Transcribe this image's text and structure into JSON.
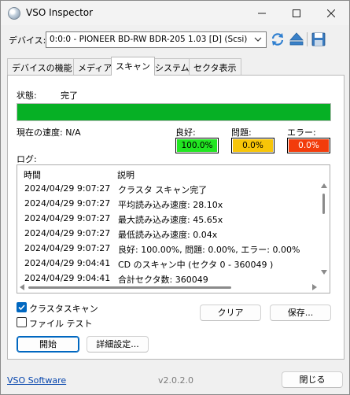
{
  "window": {
    "title": "VSO Inspector",
    "icons": {
      "app": "disc-icon",
      "minimize": "minimize-icon",
      "maximize": "maximize-icon",
      "close": "close-icon"
    }
  },
  "device": {
    "label": "デバイス:",
    "selected": "0:0:0 - PIONEER BD-RW   BDR-205 1.03 [D] (Scsi)",
    "icons": {
      "refresh": "refresh-icon",
      "eject": "eject-icon",
      "save": "save-icon"
    }
  },
  "tabs": [
    {
      "label": "デバイスの機能",
      "active": false
    },
    {
      "label": "メディア",
      "active": false
    },
    {
      "label": "スキャン",
      "active": true
    },
    {
      "label": "システム",
      "active": false
    },
    {
      "label": "セクタ表示",
      "active": false
    }
  ],
  "scan": {
    "status_label": "状態:",
    "status_value": "完了",
    "progress_percent": 100,
    "speed_label": "現在の速度: N/A",
    "good": {
      "label": "良好:",
      "value": "100.0%",
      "color": "#21e621"
    },
    "problem": {
      "label": "問題:",
      "value": "0.0%",
      "color": "#f7c508"
    },
    "error": {
      "label": "エラー:",
      "value": "0.0%",
      "color": "#f23c0c"
    },
    "log_label": "ログ:"
  },
  "log": {
    "columns": [
      "時間",
      "説明"
    ],
    "rows": [
      {
        "time": "2024/04/29 9:07:27",
        "desc": "クラスタ スキャン完了"
      },
      {
        "time": "2024/04/29 9:07:27",
        "desc": "平均読み込み速度: 28.10x"
      },
      {
        "time": "2024/04/29 9:07:27",
        "desc": "最大読み込み速度: 45.65x"
      },
      {
        "time": "2024/04/29 9:07:27",
        "desc": "最低読み込み速度: 0.04x"
      },
      {
        "time": "2024/04/29 9:07:27",
        "desc": "良好: 100.00%, 問題: 0.00%, エラー: 0.00%"
      },
      {
        "time": "2024/04/29 9:04:41",
        "desc": "CD のスキャン中 (セクタ 0 - 360049 )"
      },
      {
        "time": "2024/04/29 9:04:41",
        "desc": "合計セクタ数: 360049"
      }
    ]
  },
  "options": {
    "cluster_scan": {
      "label": "クラスタスキャン",
      "checked": true
    },
    "file_test": {
      "label": "ファイル テスト",
      "checked": false
    }
  },
  "buttons": {
    "clear": "クリア",
    "save": "保存...",
    "start": "開始",
    "advanced": "詳細設定...",
    "close": "閉じる"
  },
  "footer": {
    "link": "VSO Software",
    "version": "v2.0.2.0"
  },
  "colors": {
    "accent": "#0067c0",
    "progress": "#06b025"
  }
}
